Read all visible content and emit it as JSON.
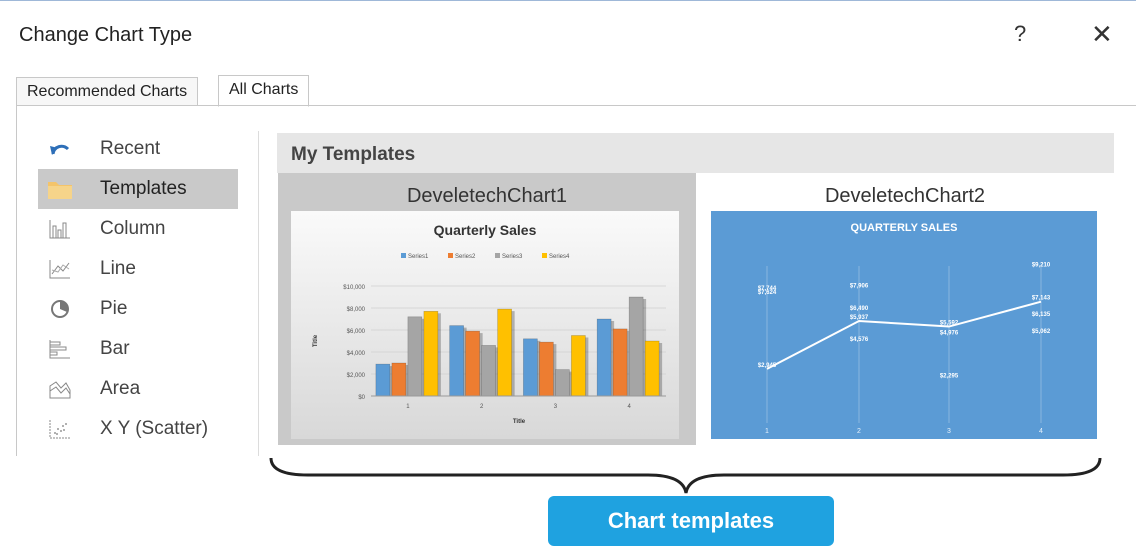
{
  "dialog": {
    "title": "Change Chart Type",
    "help_label": "?",
    "close_label": "✕"
  },
  "tabs": [
    {
      "label": "Recommended Charts",
      "active": false
    },
    {
      "label": "All Charts",
      "active": true
    }
  ],
  "sidebar": {
    "items": [
      {
        "label": "Recent",
        "icon": "undo-icon"
      },
      {
        "label": "Templates",
        "icon": "folder-icon",
        "selected": true
      },
      {
        "label": "Column",
        "icon": "column-chart-icon"
      },
      {
        "label": "Line",
        "icon": "line-chart-icon"
      },
      {
        "label": "Pie",
        "icon": "pie-chart-icon"
      },
      {
        "label": "Bar",
        "icon": "bar-chart-icon"
      },
      {
        "label": "Area",
        "icon": "area-chart-icon"
      },
      {
        "label": "X Y (Scatter)",
        "icon": "scatter-chart-icon"
      }
    ]
  },
  "section": {
    "title": "My Templates"
  },
  "templates": [
    {
      "name": "DeveletechChart1",
      "chart_data": {
        "type": "bar",
        "title": "Quarterly Sales",
        "xlabel": "Title",
        "ylabel": "Title",
        "categories": [
          "1",
          "2",
          "3",
          "4"
        ],
        "ylim": [
          0,
          10000
        ],
        "yticks": [
          "$0",
          "$2,000",
          "$4,000",
          "$6,000",
          "$8,000",
          "$10,000"
        ],
        "legend_position": "top",
        "series": [
          {
            "name": "Series1",
            "color": "#5b9bd5",
            "values": [
              2900,
              6400,
              5200,
              7000
            ]
          },
          {
            "name": "Series2",
            "color": "#ed7d31",
            "values": [
              3000,
              5900,
              4900,
              6100
            ]
          },
          {
            "name": "Series3",
            "color": "#a5a5a5",
            "values": [
              7200,
              4600,
              2400,
              9000
            ]
          },
          {
            "name": "Series4",
            "color": "#ffc000",
            "values": [
              7700,
              7900,
              5500,
              5000
            ]
          }
        ]
      }
    },
    {
      "name": "DeveletechChart2",
      "chart_data": {
        "type": "line",
        "title": "QUARTERLY SALES",
        "categories": [
          "1",
          "2",
          "3",
          "4"
        ],
        "ylim": [
          0,
          10000
        ],
        "background": "#5b9bd5",
        "line_values": [
          2945,
          5937,
          5592,
          7143
        ],
        "labels": [
          {
            "x": 0,
            "text": "$7,744",
            "value": 7744
          },
          {
            "x": 0,
            "text": "$7,624",
            "value": 7500
          },
          {
            "x": 0,
            "text": "$2,945",
            "value": 2945
          },
          {
            "x": 1,
            "text": "$7,906",
            "value": 7906
          },
          {
            "x": 1,
            "text": "$6,490",
            "value": 6490
          },
          {
            "x": 1,
            "text": "$5,937",
            "value": 5937
          },
          {
            "x": 1,
            "text": "$4,576",
            "value": 4576
          },
          {
            "x": 2,
            "text": "$5,592",
            "value": 5592
          },
          {
            "x": 2,
            "text": "$4,976",
            "value": 4976
          },
          {
            "x": 2,
            "text": "$2,295",
            "value": 2295
          },
          {
            "x": 3,
            "text": "$9,210",
            "value": 9210
          },
          {
            "x": 3,
            "text": "$7,143",
            "value": 7143
          },
          {
            "x": 3,
            "text": "$6,135",
            "value": 6135
          },
          {
            "x": 3,
            "text": "$5,062",
            "value": 5062
          }
        ]
      }
    }
  ],
  "callout": {
    "label": "Chart templates"
  }
}
